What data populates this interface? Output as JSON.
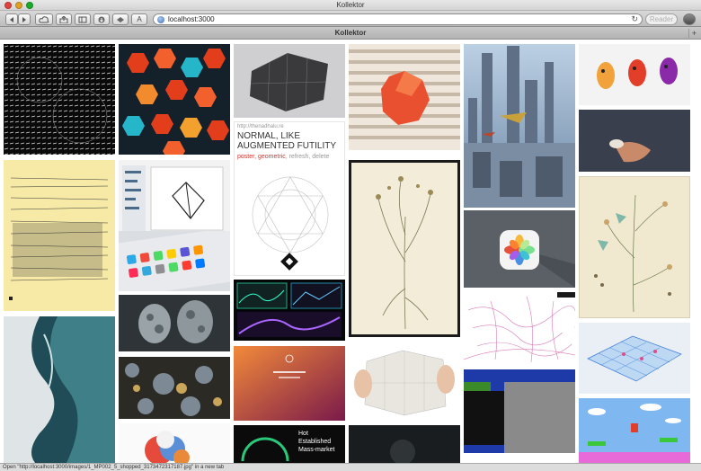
{
  "window": {
    "title": "Kollektor"
  },
  "toolbar": {
    "address": "localhost:3000",
    "reader_label": "Reader",
    "font_button": "A",
    "reload_glyph": "↻"
  },
  "tab": {
    "title": "Kollektor",
    "new_tab_glyph": "+"
  },
  "tiles": {
    "poster_url": "http://thenadhalu.re",
    "poster_title": "NORMAL, LIKE AUGMENTED FUTILITY",
    "poster_tag1": "poster",
    "poster_tag2": "geometric",
    "poster_tag3": "refresh",
    "poster_tag4": "delete",
    "ad_line1": "Hot",
    "ad_line2": "Established",
    "ad_line3": "Mass-market"
  },
  "status": {
    "text": "Open \"http://localhost:3000/images/1_MP002_5_shopped_3173472317187.jpg\" in a new tab"
  },
  "icons": [
    "back-icon",
    "forward-icon",
    "cloud-icon",
    "share-icon",
    "sidebar-icon",
    "downloads-icon",
    "globe-icon",
    "reload-icon",
    "photos-icon"
  ]
}
